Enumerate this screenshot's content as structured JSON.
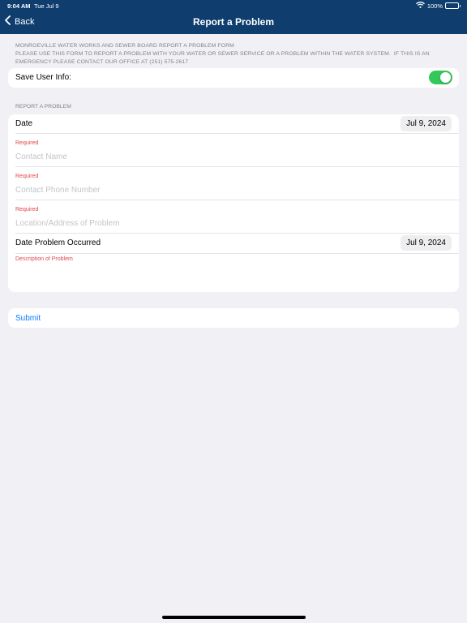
{
  "status_bar": {
    "time": "9:04 AM",
    "date": "Tue Jul 9",
    "battery": "100%",
    "wifi_icon": "wifi-icon",
    "battery_icon": "battery-icon"
  },
  "nav": {
    "back_label": "Back",
    "back_icon": "chevron-left-icon",
    "title": "Report a Problem",
    "bar_color": "#0e3d6e"
  },
  "intro": {
    "line1": "MONROEVILLE WATER WORKS AND SEWER BOARD REPORT A PROBLEM FORM",
    "line2": "PLEASE USE THIS FORM TO REPORT A PROBLEM WITH YOUR WATER OR SEWER SERVICE OR A PROBLEM WITHIN THE WATER SYSTEM.  IF THIS IS AN",
    "line3": "EMERGENCY PLEASE CONTACT OUR OFFICE AT (251) 575-2617"
  },
  "save_user_info": {
    "label": "Save User Info:",
    "enabled": true,
    "toggle_color": "#34c759"
  },
  "form": {
    "section_header": "REPORT A PROBLEM",
    "date_label": "Date",
    "date_value": "Jul 9, 2024",
    "contact_name": {
      "required": "Required",
      "placeholder": "Contact Name"
    },
    "contact_phone": {
      "required": "Required",
      "placeholder": "Contact Phone Number"
    },
    "location": {
      "required": "Required",
      "placeholder": "Location/Address of Problem"
    },
    "date_occurred_label": "Date Problem Occurred",
    "date_occurred_value": "Jul 9, 2024",
    "description_label": "Description of Problem",
    "required_color": "#e0474b"
  },
  "submit": {
    "label": "Submit",
    "color": "#0a7aff"
  }
}
